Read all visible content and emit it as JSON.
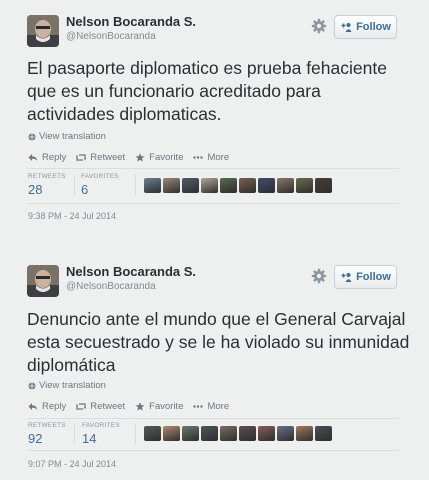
{
  "tweets": [
    {
      "name": "Nelson Bocaranda S.",
      "handle": "@NelsonBocaranda",
      "follow_label": "Follow",
      "text": "El pasaporte diplomatico es prueba fehaciente que es un funcionario acreditado para actividades diplomaticas.",
      "view_translation": "View translation",
      "actions": [
        "Reply",
        "Retweet",
        "Favorite",
        "More"
      ],
      "retweets_label": "RETWEETS",
      "retweets": "28",
      "favorites_label": "FAVORITES",
      "favorites": "6",
      "timestamp": "9:38 PM - 24 Jul 2014",
      "favoriter_colors": [
        "#6d7f94",
        "#9a8a7c",
        "#4e5b6a",
        "#b3a596",
        "#5a6a4e",
        "#7a5e4f",
        "#3e4d6e",
        "#8a7866",
        "#6b6a50",
        "#4a3f36"
      ]
    },
    {
      "name": "Nelson Bocaranda S.",
      "handle": "@NelsonBocaranda",
      "follow_label": "Follow",
      "text": "Denuncio ante el mundo que el General Carvajal esta secuestrado y se le ha violado su inmunidad diplomática",
      "view_translation": "View translation",
      "actions": [
        "Reply",
        "Retweet",
        "Favorite",
        "More"
      ],
      "retweets_label": "RETWEETS",
      "retweets": "92",
      "favorites_label": "FAVORITES",
      "favorites": "14",
      "timestamp": "9:07 PM - 24 Jul 2014",
      "favoriter_colors": [
        "#555a5e",
        "#b08a6e",
        "#6a7a6e",
        "#4e5558",
        "#7a6e5e",
        "#5e4e4e",
        "#8a5a5a",
        "#6a6f8a",
        "#9e7a5a",
        "#4a4e56"
      ]
    }
  ]
}
